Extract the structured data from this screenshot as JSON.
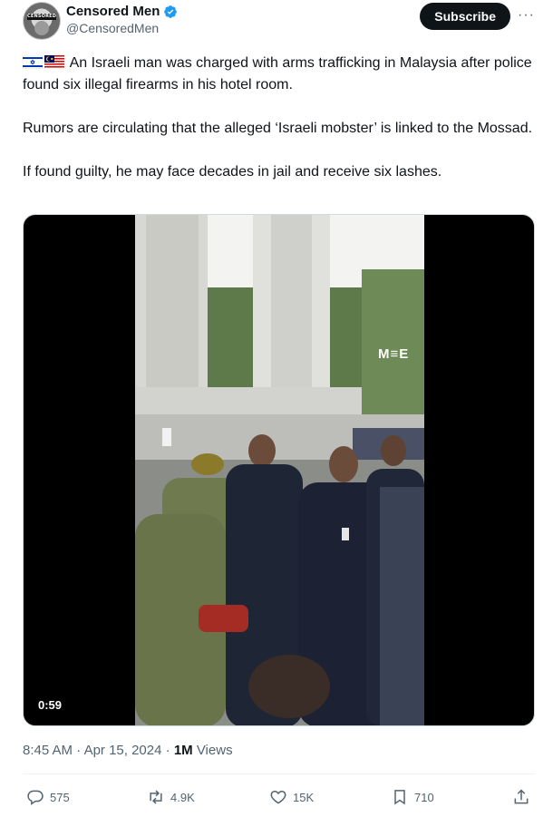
{
  "author": {
    "display_name": "Censored Men",
    "handle": "@CensoredMen",
    "avatar_text": "CENSORED"
  },
  "subscribe_label": "Subscribe",
  "more_label": "···",
  "tweet": {
    "flags": [
      "israel-flag",
      "malaysia-flag"
    ],
    "paragraph1": "An Israeli man was charged with arms trafficking in Malaysia after police found six illegal firearms in his hotel room.",
    "paragraph2": "Rumors are circulating that the alleged ‘Israeli mobster’ is linked to the Mossad.",
    "paragraph3": "If found guilty, he may face decades in jail and receive six lashes."
  },
  "media": {
    "watermark": "M≡E",
    "duration": "0:59"
  },
  "meta": {
    "time": "8:45 AM",
    "separator": " · ",
    "date": "Apr 15, 2024",
    "views_count": "1M",
    "views_label": " Views"
  },
  "actions": {
    "replies": "575",
    "reposts": "4.9K",
    "likes": "15K",
    "bookmarks": "710"
  },
  "colors": {
    "accent_blue": "#1d9bf0",
    "text_primary": "#0f1419",
    "text_secondary": "#536471"
  }
}
